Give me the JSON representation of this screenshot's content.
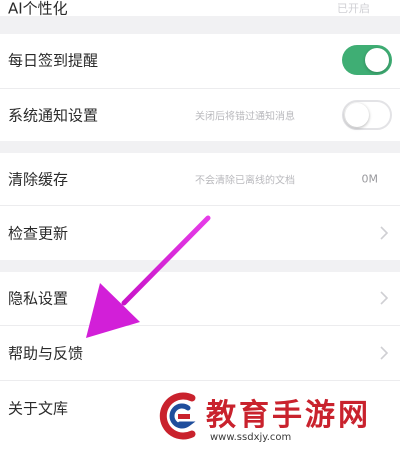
{
  "settings": {
    "top_partial": {
      "label": "AI个性化",
      "value": "已开启"
    },
    "rows": [
      {
        "label": "每日签到提醒"
      },
      {
        "label": "系统通知设置",
        "hint": "关闭后将错过通知消息"
      },
      {
        "label": "清除缓存",
        "hint": "不会清除已离线的文档",
        "value": "0M"
      },
      {
        "label": "检查更新"
      },
      {
        "label": "隐私设置"
      },
      {
        "label": "帮助与反馈"
      },
      {
        "label": "关于文库"
      }
    ]
  },
  "toggles": {
    "daily_checkin": true,
    "system_notice": false
  },
  "colors": {
    "toggle_on": "#3fae74",
    "arrow": "#d21fd8",
    "watermark_red": "#c9222d"
  },
  "watermark": {
    "logo": "G",
    "title": "教育手游网",
    "url": "www.ssdxjy.com"
  }
}
